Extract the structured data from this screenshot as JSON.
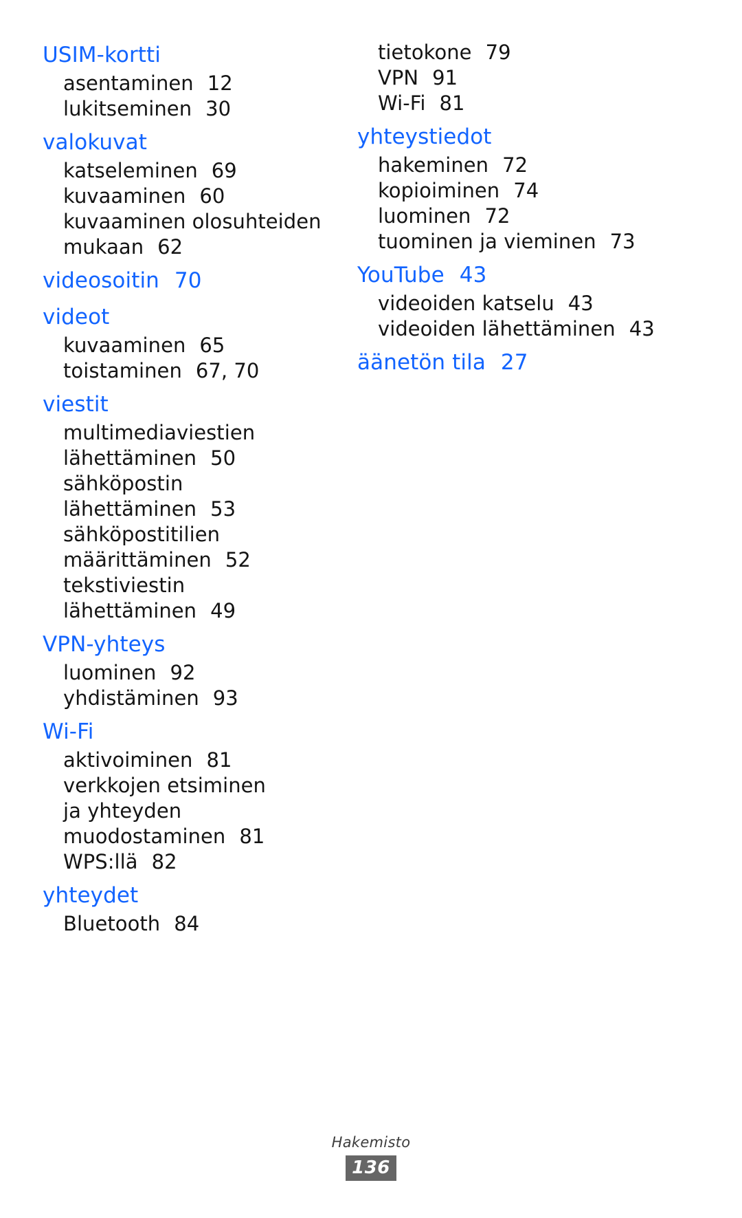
{
  "document": {
    "language": "fi",
    "accent_color": "#1264ff",
    "text_color": "#141414",
    "badge_color": "#666666"
  },
  "index": {
    "left_column": [
      {
        "heading": "USIM-kortti",
        "heading_page": "",
        "entries": [
          {
            "text": "asentaminen",
            "page": "12"
          },
          {
            "text": "lukitseminen",
            "page": "30"
          }
        ]
      },
      {
        "heading": "valokuvat",
        "heading_page": "",
        "entries": [
          {
            "text": "katseleminen",
            "page": "69"
          },
          {
            "text": "kuvaaminen",
            "page": "60"
          },
          {
            "text": "kuvaaminen olosuhteiden",
            "page": ""
          },
          {
            "text": "mukaan",
            "page": "62"
          }
        ]
      },
      {
        "heading": "videosoitin",
        "heading_page": "70",
        "entries": []
      },
      {
        "heading": "videot",
        "heading_page": "",
        "entries": [
          {
            "text": "kuvaaminen",
            "page": "65"
          },
          {
            "text": "toistaminen",
            "page": "67, 70"
          }
        ]
      },
      {
        "heading": "viestit",
        "heading_page": "",
        "entries": [
          {
            "text": "multimediaviestien",
            "page": ""
          },
          {
            "text": "lähettäminen",
            "page": "50"
          },
          {
            "text": "sähköpostin",
            "page": ""
          },
          {
            "text": "lähettäminen",
            "page": "53"
          },
          {
            "text": "sähköpostitilien",
            "page": ""
          },
          {
            "text": "määrittäminen",
            "page": "52"
          },
          {
            "text": "tekstiviestin",
            "page": ""
          },
          {
            "text": "lähettäminen",
            "page": "49"
          }
        ]
      },
      {
        "heading": "VPN-yhteys",
        "heading_page": "",
        "entries": [
          {
            "text": "luominen",
            "page": "92"
          },
          {
            "text": "yhdistäminen",
            "page": "93"
          }
        ]
      },
      {
        "heading": "Wi-Fi",
        "heading_page": "",
        "entries": [
          {
            "text": "aktivoiminen",
            "page": "81"
          },
          {
            "text": "verkkojen etsiminen",
            "page": ""
          },
          {
            "text": "ja yhteyden",
            "page": ""
          },
          {
            "text": "muodostaminen",
            "page": "81"
          },
          {
            "text": "WPS:llä",
            "page": "82"
          }
        ]
      },
      {
        "heading": "yhteydet",
        "heading_page": "",
        "entries": [
          {
            "text": "Bluetooth",
            "page": "84"
          }
        ]
      }
    ],
    "right_column": [
      {
        "heading": "",
        "heading_page": "",
        "entries": [
          {
            "text": "tietokone",
            "page": "79"
          },
          {
            "text": "VPN",
            "page": "91"
          },
          {
            "text": "Wi-Fi",
            "page": "81"
          }
        ]
      },
      {
        "heading": "yhteystiedot",
        "heading_page": "",
        "entries": [
          {
            "text": "hakeminen",
            "page": "72"
          },
          {
            "text": "kopioiminen",
            "page": "74"
          },
          {
            "text": "luominen",
            "page": "72"
          },
          {
            "text": "tuominen ja vieminen",
            "page": "73"
          }
        ]
      },
      {
        "heading": "YouTube",
        "heading_page": "43",
        "entries": [
          {
            "text": "videoiden katselu",
            "page": "43"
          },
          {
            "text": "videoiden lähettäminen",
            "page": "43"
          }
        ]
      },
      {
        "heading": "äänetön tila",
        "heading_page": "27",
        "entries": []
      }
    ]
  },
  "footer": {
    "label": "Hakemisto",
    "page_number": "136"
  }
}
